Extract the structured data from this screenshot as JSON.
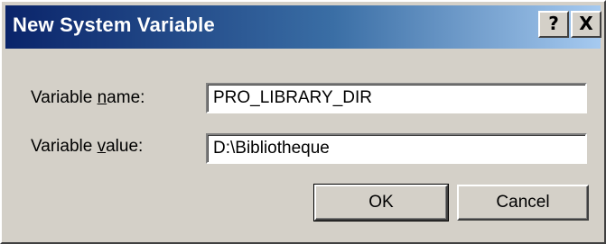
{
  "window": {
    "title": "New System Variable"
  },
  "titlebar_buttons": {
    "help": "?",
    "close": "X"
  },
  "fields": {
    "name_label_pre": "Variable ",
    "name_label_accel": "n",
    "name_label_post": "ame:",
    "name_value": "PRO_LIBRARY_DIR",
    "value_label_pre": "Variable ",
    "value_label_accel": "v",
    "value_label_post": "alue:",
    "value_value": "D:\\Bibliotheque"
  },
  "buttons": {
    "ok": "OK",
    "cancel": "Cancel"
  }
}
